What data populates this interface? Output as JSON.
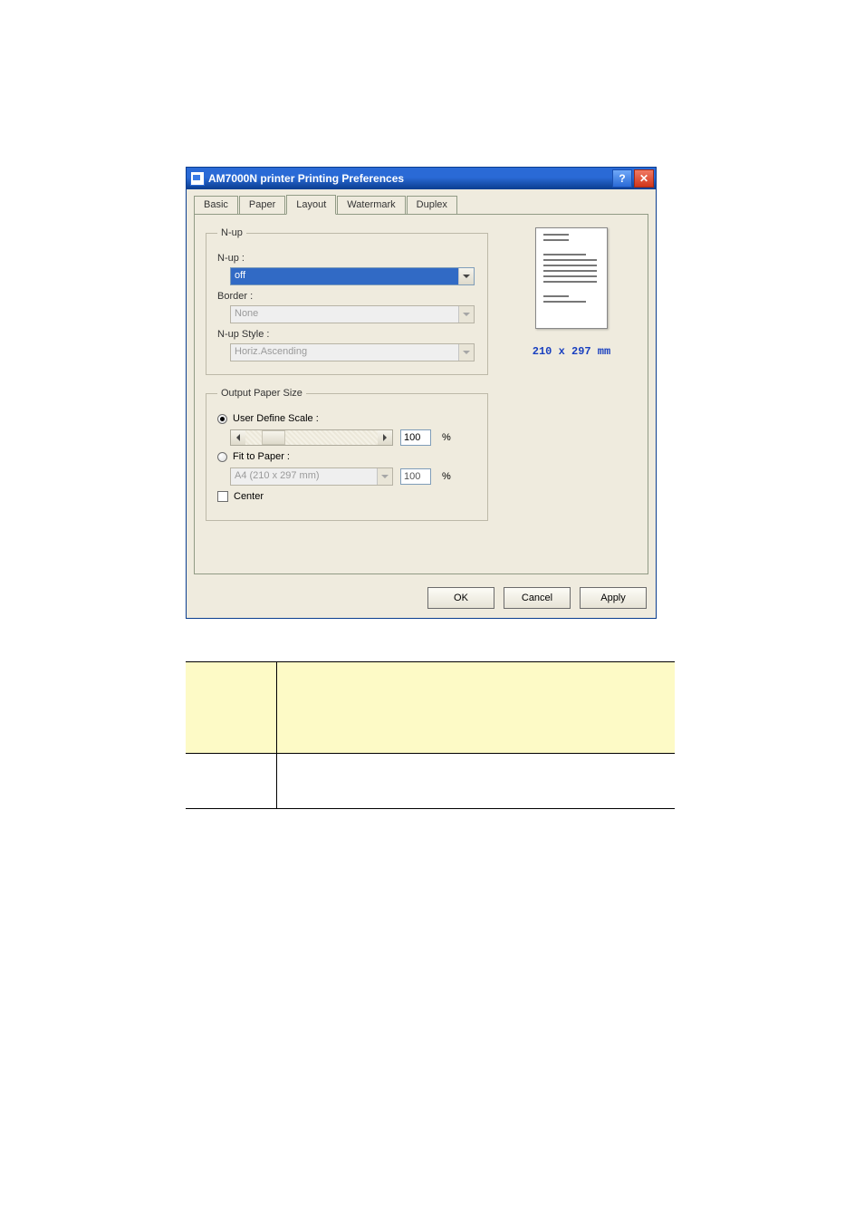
{
  "dialog": {
    "title": "AM7000N printer Printing Preferences",
    "help_label": "?",
    "close_label": "✕"
  },
  "tabs": {
    "items": [
      {
        "label": "Basic",
        "active": false
      },
      {
        "label": "Paper",
        "active": false
      },
      {
        "label": "Layout",
        "active": true
      },
      {
        "label": "Watermark",
        "active": false
      },
      {
        "label": "Duplex",
        "active": false
      }
    ]
  },
  "nup_group": {
    "legend": "N-up",
    "nup_label": "N-up :",
    "nup_value": "off",
    "border_label": "Border :",
    "border_value": "None",
    "style_label": "N-up Style :",
    "style_value": "Horiz.Ascending"
  },
  "output_group": {
    "legend": "Output Paper Size",
    "user_define_label": "User Define Scale :",
    "user_define_value": "100",
    "fit_label": "Fit to Paper :",
    "fit_paper_value": "A4 (210 x 297 mm)",
    "fit_percent_value": "100",
    "center_label": "Center",
    "percent_symbol": "%"
  },
  "preview": {
    "paper_dimensions": "210 x 297 mm"
  },
  "buttons": {
    "ok": "OK",
    "cancel": "Cancel",
    "apply": "Apply"
  }
}
